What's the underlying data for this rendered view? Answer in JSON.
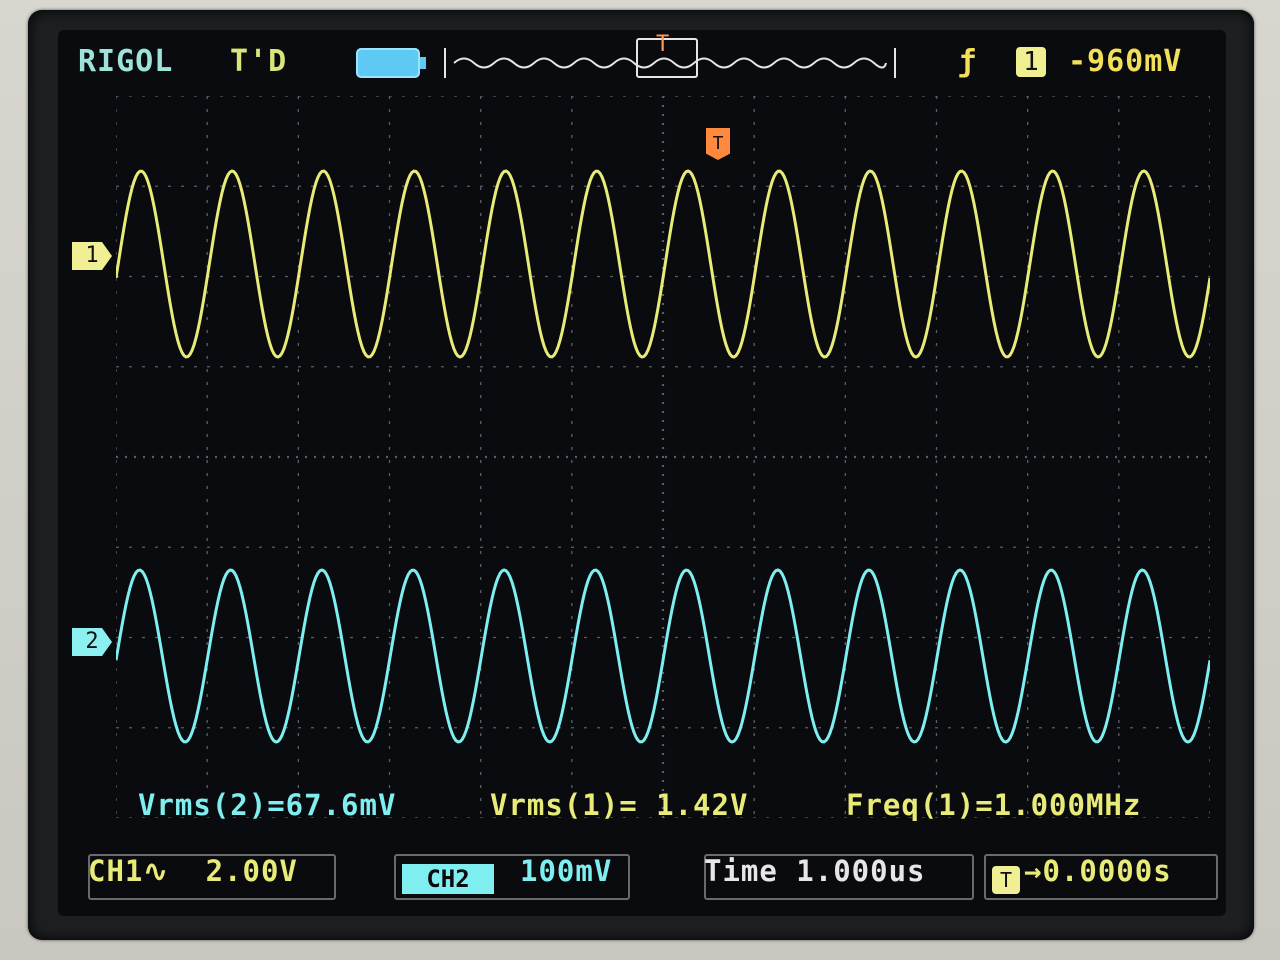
{
  "header": {
    "brand": "RIGOL",
    "status": "T'D",
    "trigger_channel": "1",
    "trigger_level": "-960mV"
  },
  "markers": {
    "ch1": "1",
    "ch2": "2",
    "trigger": "T"
  },
  "measurements": {
    "vrms2": "Vrms(2)=67.6mV",
    "vrms1": "Vrms(1)= 1.42V",
    "freq1": "Freq(1)=1.000MHz"
  },
  "status_bar": {
    "ch1_scale": "CH1∿  2.00V",
    "ch2_label": "CH2",
    "ch2_scale": "100mV",
    "time_label": "Time 1.000us",
    "trigger_offset": "→0.0000s"
  },
  "colors": {
    "ch1": "#e9eb79",
    "ch2": "#7feef0",
    "trigger": "#ff9a52",
    "grid": "#5b5f65"
  }
}
